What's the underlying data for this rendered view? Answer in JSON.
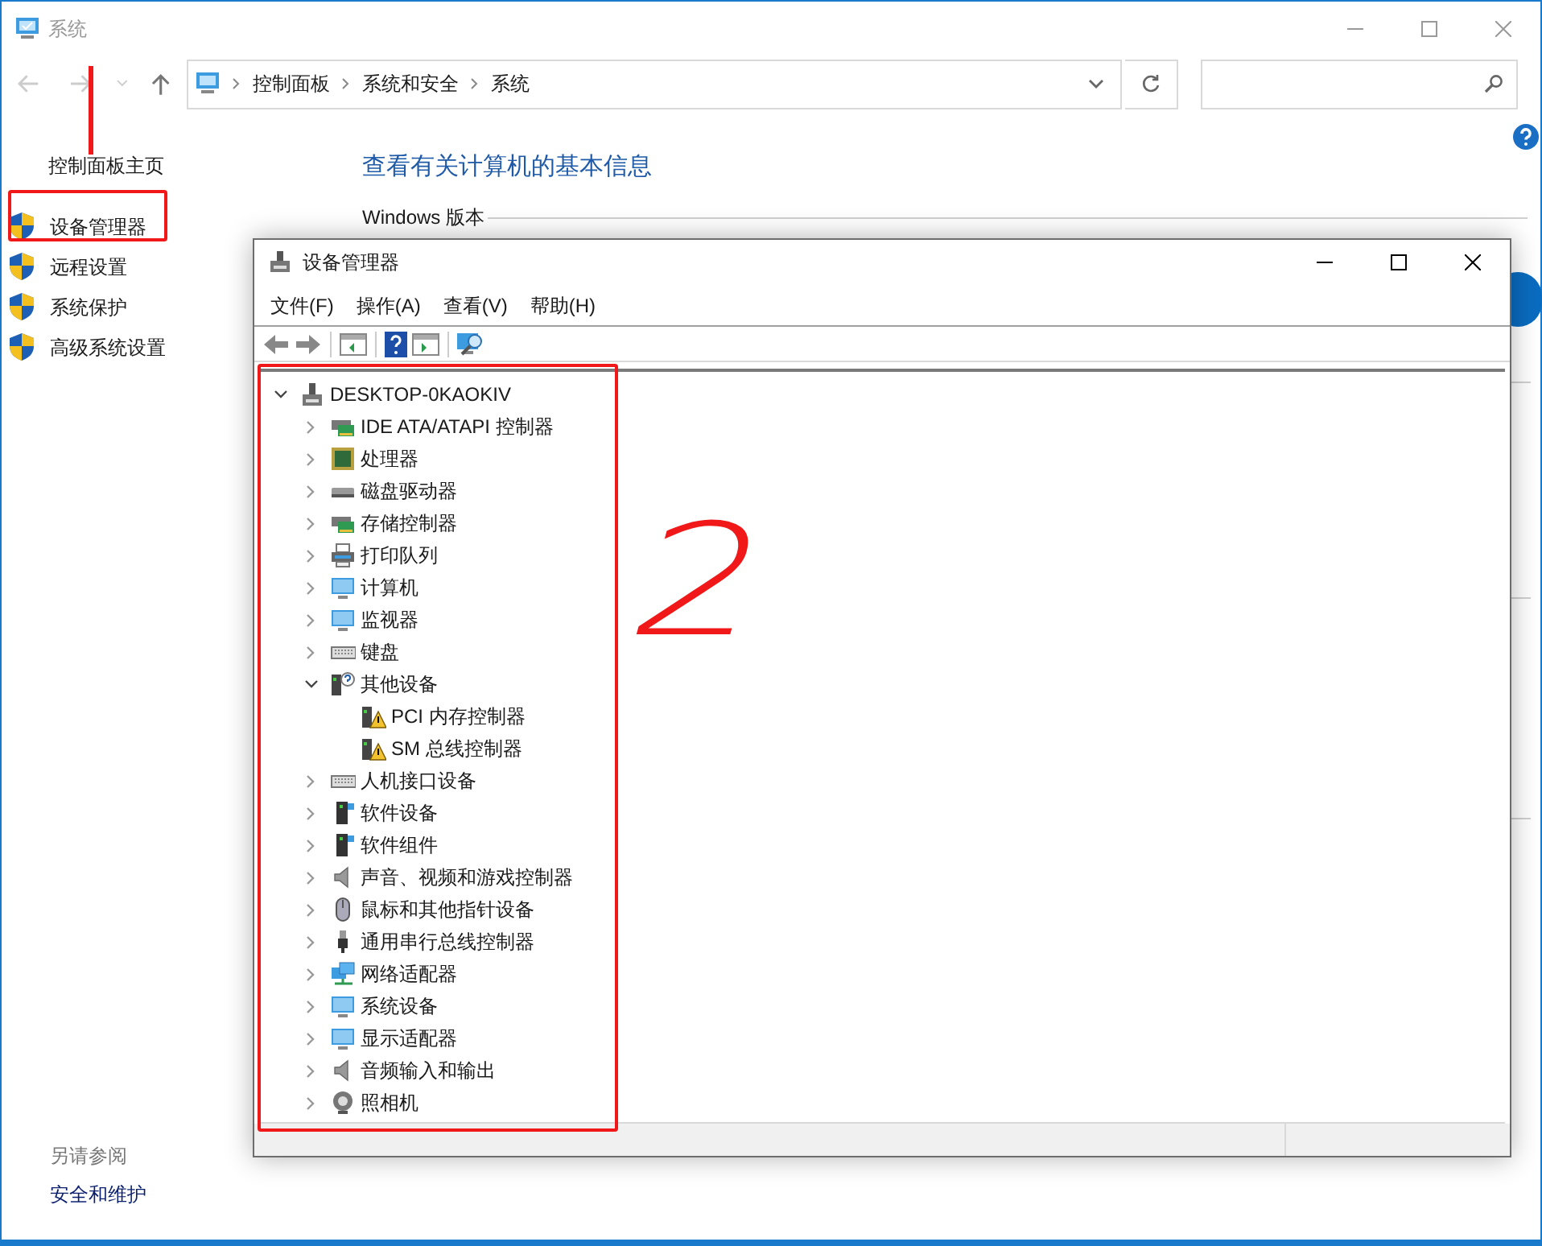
{
  "main_window": {
    "title": "系统",
    "breadcrumb": [
      "控制面板",
      "系统和安全",
      "系统"
    ]
  },
  "sidebar": {
    "home": "控制面板主页",
    "links": [
      "设备管理器",
      "远程设置",
      "系统保护",
      "高级系统设置"
    ],
    "see_also": {
      "heading": "另请参阅",
      "links": [
        "安全和维护"
      ]
    }
  },
  "content": {
    "heading": "查看有关计算机的基本信息",
    "section": "Windows 版本"
  },
  "device_manager": {
    "title": "设备管理器",
    "menu": [
      "文件(F)",
      "操作(A)",
      "查看(V)",
      "帮助(H)"
    ],
    "tree": {
      "label": "DESKTOP-0KAOKIV",
      "kind": "computer",
      "expanded": true,
      "children": [
        {
          "label": "IDE ATA/ATAPI 控制器",
          "kind": "card",
          "expanded": false
        },
        {
          "label": "处理器",
          "kind": "chip",
          "expanded": false
        },
        {
          "label": "磁盘驱动器",
          "kind": "disk",
          "expanded": false
        },
        {
          "label": "存储控制器",
          "kind": "card",
          "expanded": false
        },
        {
          "label": "打印队列",
          "kind": "printer",
          "expanded": false
        },
        {
          "label": "计算机",
          "kind": "monitor",
          "expanded": false
        },
        {
          "label": "监视器",
          "kind": "monitor",
          "expanded": false
        },
        {
          "label": "键盘",
          "kind": "keyboard",
          "expanded": false
        },
        {
          "label": "其他设备",
          "kind": "unknown",
          "expanded": true,
          "children": [
            {
              "label": "PCI 内存控制器",
              "kind": "warning"
            },
            {
              "label": "SM 总线控制器",
              "kind": "warning"
            }
          ]
        },
        {
          "label": "人机接口设备",
          "kind": "keyboard",
          "expanded": false
        },
        {
          "label": "软件设备",
          "kind": "tower",
          "expanded": false
        },
        {
          "label": "软件组件",
          "kind": "tower",
          "expanded": false
        },
        {
          "label": "声音、视频和游戏控制器",
          "kind": "speaker",
          "expanded": false
        },
        {
          "label": "鼠标和其他指针设备",
          "kind": "mouse",
          "expanded": false
        },
        {
          "label": "通用串行总线控制器",
          "kind": "usb",
          "expanded": false
        },
        {
          "label": "网络适配器",
          "kind": "network",
          "expanded": false
        },
        {
          "label": "系统设备",
          "kind": "monitor",
          "expanded": false
        },
        {
          "label": "显示适配器",
          "kind": "monitor",
          "expanded": false
        },
        {
          "label": "音频输入和输出",
          "kind": "speaker",
          "expanded": false
        },
        {
          "label": "照相机",
          "kind": "camera",
          "expanded": false
        }
      ]
    }
  },
  "annotations": [
    {
      "kind": "line"
    },
    {
      "kind": "box"
    },
    {
      "kind": "box"
    },
    {
      "kind": "label",
      "text": "2"
    }
  ]
}
